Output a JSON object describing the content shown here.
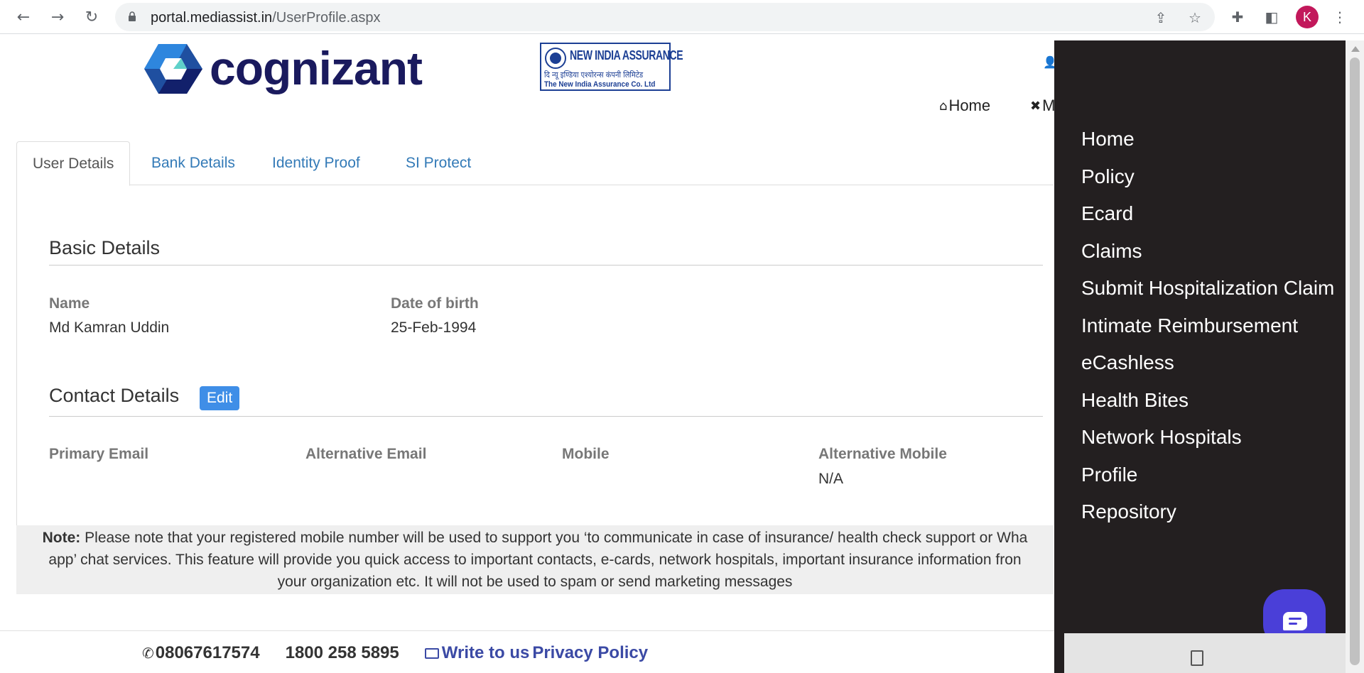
{
  "browser": {
    "url_host": "portal.mediassist.in",
    "url_path": "/UserProfile.aspx",
    "avatar_initial": "K",
    "icons": [
      "back-icon",
      "forward-icon",
      "reload-icon",
      "lock-icon",
      "share-icon",
      "star-icon",
      "extensions-icon",
      "sidepanel-icon",
      "menu-icon"
    ]
  },
  "header": {
    "brand": "cognizant",
    "partner_title": "NEW INDIA ASSURANCE",
    "partner_hindi": "दि न्यू इण्डिया एश्योरन्स कंपनी लिमिटेड",
    "partner_sub": "The New India Assurance Co. Ltd",
    "nav_home": "Home",
    "nav_m": "M"
  },
  "tabs": [
    {
      "label": "User Details",
      "active": true
    },
    {
      "label": "Bank Details",
      "active": false
    },
    {
      "label": "Identity Proof",
      "active": false
    },
    {
      "label": "SI Protect",
      "active": false
    }
  ],
  "basic": {
    "title": "Basic Details",
    "name_label": "Name",
    "name_value": "Md Kamran Uddin",
    "dob_label": "Date of birth",
    "dob_value": "25-Feb-1994"
  },
  "contact": {
    "title": "Contact Details",
    "edit_label": "Edit",
    "primary_email_label": "Primary Email",
    "alt_email_label": "Alternative Email",
    "mobile_label": "Mobile",
    "alt_mobile_label": "Alternative Mobile",
    "alt_mobile_value": "N/A"
  },
  "note": {
    "label": "Note:",
    "line1": "Please note that your registered mobile number will be used to support you ‘to communicate in case of insurance/ health check support or Wha",
    "line2": "app’ chat services. This feature will provide you quick access to important contacts, e-cards, network hospitals, important insurance information fron",
    "line3": "your organization etc. It will not be used to spam or send marketing messages"
  },
  "footer": {
    "phone": "08067617574",
    "tollfree": "1800 258 5895",
    "write": "Write to us",
    "privacy": "Privacy Policy"
  },
  "sidemenu": {
    "items": [
      "Home",
      "Policy",
      "Ecard",
      "Claims",
      "Submit Hospitalization Claim",
      "Intimate Reimbursement",
      "eCashless",
      "Health Bites",
      "Network Hospitals",
      "Profile",
      "Repository"
    ]
  },
  "colors": {
    "sidemenu_bg": "#231f20",
    "tab_link": "#337ab7",
    "edit_button": "#3f8ee7",
    "chat_bubble": "#4a3fd8",
    "avatar": "#c2185b"
  }
}
